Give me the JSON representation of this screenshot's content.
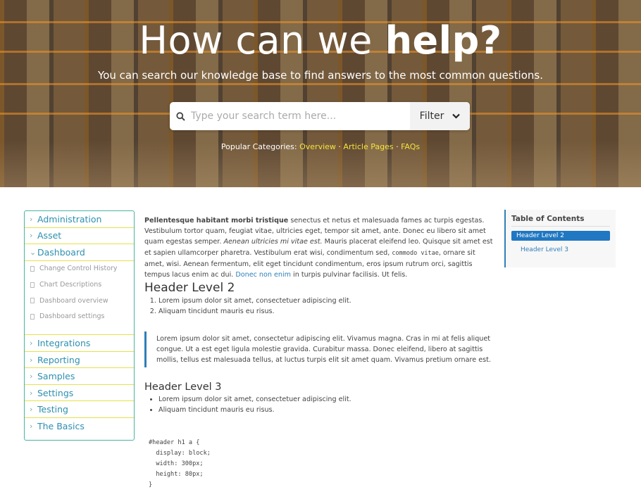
{
  "hero": {
    "title_plain": "How can we ",
    "title_bold": "help?",
    "subtitle": "You can search our knowledge base to find answers to the most common questions.",
    "search_placeholder": "Type your search term here...",
    "filter_label": "Filter",
    "popular_label": "Popular Categories: ",
    "popular": [
      "Overview",
      "Article Pages",
      "FAQs"
    ],
    "popular_sep": " · "
  },
  "sidebar": {
    "items_top": [
      "Administration",
      "Asset",
      "Dashboard"
    ],
    "dashboard_children": [
      "Change Control History",
      "Chart Descriptions",
      "Dashboard overview",
      "Dashboard settings"
    ],
    "items_bottom": [
      "Integrations",
      "Reporting",
      "Samples",
      "Settings",
      "Testing",
      "The Basics"
    ]
  },
  "article": {
    "intro_bold": "Pellentesque habitant morbi tristique",
    "intro_1": " senectus et netus et malesuada fames ac turpis egestas. Vestibulum tortor quam, feugiat vitae, ultricies eget, tempor sit amet, ante. Donec eu libero sit amet quam egestas semper. ",
    "intro_em": "Aenean ultricies mi vitae est.",
    "intro_2": " Mauris placerat eleifend leo. Quisque sit amet est et sapien ullamcorper pharetra. Vestibulum erat wisi, condimentum sed, ",
    "intro_code": "commodo vitae",
    "intro_3": ", ornare sit amet, wisi. Aenean fermentum, elit eget tincidunt condimentum, eros ipsum rutrum orci, sagittis tempus lacus enim ac dui. ",
    "intro_link": "Donec non enim",
    "intro_4": " in turpis pulvinar facilisis. Ut felis.",
    "h2": "Header Level 2",
    "ol": [
      "Lorem ipsum dolor sit amet, consectetuer adipiscing elit.",
      "Aliquam tincidunt mauris eu risus."
    ],
    "quote": "Lorem ipsum dolor sit amet, consectetur adipiscing elit. Vivamus magna. Cras in mi at felis aliquet congue. Ut a est eget ligula molestie gravida. Curabitur massa. Donec eleifend, libero at sagittis mollis, tellus est malesuada tellus, at luctus turpis elit sit amet quam. Vivamus pretium ornare est.",
    "h3": "Header Level 3",
    "ul": [
      "Lorem ipsum dolor sit amet, consectetuer adipiscing elit.",
      "Aliquam tincidunt mauris eu risus."
    ],
    "code": "#header h1 a {\n  display: block;\n  width: 300px;\n  height: 80px;\n}"
  },
  "toc": {
    "title": "Table of Contents",
    "items": [
      "Header Level 2",
      "Header Level 3"
    ]
  },
  "colors": {
    "accent": "#2077c2",
    "link": "#2e8fb0",
    "highlight": "#f5e23c",
    "sidebar_border": "#4bb3a0",
    "divider": "#e6e04a"
  }
}
